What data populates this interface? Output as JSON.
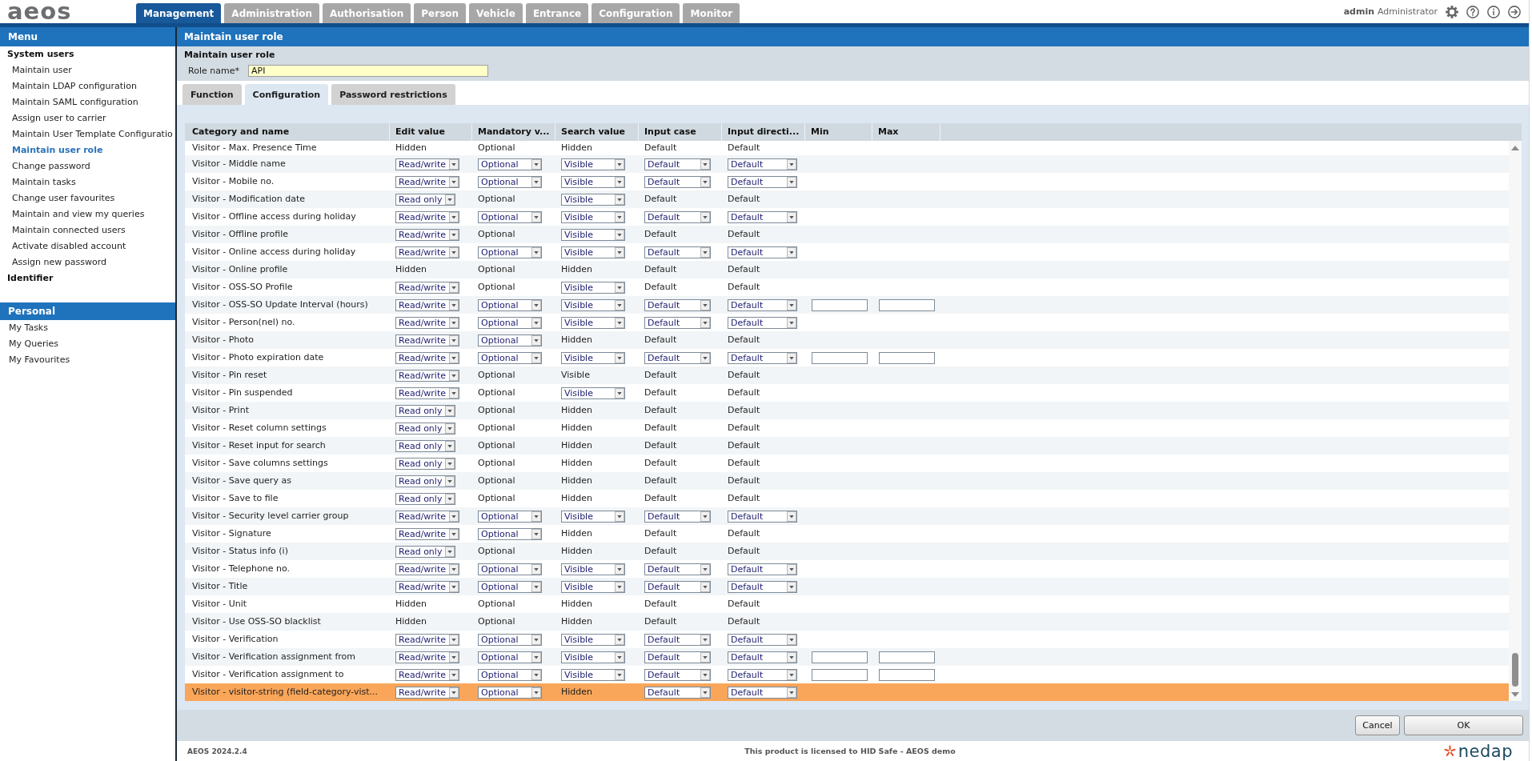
{
  "top_bar": {
    "logo": "aeos",
    "tabs": [
      {
        "label": "Management",
        "selected": true
      },
      {
        "label": "Administration",
        "selected": false
      },
      {
        "label": "Authorisation",
        "selected": false
      },
      {
        "label": "Person",
        "selected": false
      },
      {
        "label": "Vehicle",
        "selected": false
      },
      {
        "label": "Entrance",
        "selected": false
      },
      {
        "label": "Configuration",
        "selected": false
      },
      {
        "label": "Monitor",
        "selected": false
      }
    ],
    "user": {
      "login": "admin",
      "role": "Administrator"
    }
  },
  "sidebar": {
    "menu": {
      "title": "Menu",
      "groups": [
        {
          "label": "System users",
          "children": [
            {
              "label": "Maintain user",
              "selected": false
            },
            {
              "label": "Maintain LDAP configuration",
              "selected": false
            },
            {
              "label": "Maintain SAML configuration",
              "selected": false
            },
            {
              "label": "Assign user to carrier",
              "selected": false
            },
            {
              "label": "Maintain User Template Configuratio",
              "selected": false
            },
            {
              "label": "Maintain user role",
              "selected": true
            },
            {
              "label": "Change password",
              "selected": false
            },
            {
              "label": "Maintain tasks",
              "selected": false
            },
            {
              "label": "Change user favourites",
              "selected": false
            },
            {
              "label": "Maintain and view my queries",
              "selected": false
            },
            {
              "label": "Maintain connected users",
              "selected": false
            },
            {
              "label": "Activate disabled account",
              "selected": false
            },
            {
              "label": "Assign new password",
              "selected": false
            }
          ]
        },
        {
          "label": "Identifier"
        }
      ]
    },
    "personal": {
      "title": "Personal",
      "items": [
        {
          "label": "My Tasks",
          "selected": false
        },
        {
          "label": "My Queries",
          "selected": false
        },
        {
          "label": "My Favourites",
          "selected": false
        }
      ]
    }
  },
  "page": {
    "title": "Maintain user role",
    "form": {
      "title": "Maintain user role",
      "role_name": {
        "label": "Role name*",
        "value": "API"
      }
    },
    "tabs": [
      {
        "label": "Function",
        "selected": false
      },
      {
        "label": "Configuration",
        "selected": true
      },
      {
        "label": "Password restrictions",
        "selected": false
      }
    ],
    "table": {
      "columns": [
        "Category and name",
        "Edit value",
        "Mandatory v...",
        "Search value",
        "Input case",
        "Input directi...",
        "Min",
        "Max"
      ],
      "rows": [
        {
          "cells": [
            {
              "kind": "text",
              "value": "Visitor - Max. Presence Time"
            },
            {
              "kind": "text",
              "value": "Hidden"
            },
            {
              "kind": "text",
              "value": "Optional"
            },
            {
              "kind": "text",
              "value": "Hidden"
            },
            {
              "kind": "text",
              "value": "Default"
            },
            {
              "kind": "text",
              "value": "Default"
            }
          ],
          "selected": false
        },
        {
          "cells": [
            {
              "kind": "text",
              "value": "Visitor - Middle name"
            },
            {
              "kind": "select",
              "value": "Read/write"
            },
            {
              "kind": "select",
              "value": "Optional"
            },
            {
              "kind": "select",
              "value": "Visible"
            },
            {
              "kind": "select",
              "value": "Default"
            },
            {
              "kind": "select",
              "value": "Default"
            }
          ],
          "selected": false
        },
        {
          "cells": [
            {
              "kind": "text",
              "value": "Visitor - Mobile no."
            },
            {
              "kind": "select",
              "value": "Read/write"
            },
            {
              "kind": "select",
              "value": "Optional"
            },
            {
              "kind": "select",
              "value": "Visible"
            },
            {
              "kind": "select",
              "value": "Default"
            },
            {
              "kind": "select",
              "value": "Default"
            }
          ],
          "selected": false
        },
        {
          "cells": [
            {
              "kind": "text",
              "value": "Visitor - Modification date"
            },
            {
              "kind": "select",
              "value": "Read only"
            },
            {
              "kind": "text",
              "value": "Optional"
            },
            {
              "kind": "select",
              "value": "Visible"
            },
            {
              "kind": "text",
              "value": "Default"
            },
            {
              "kind": "text",
              "value": "Default"
            }
          ],
          "selected": false
        },
        {
          "cells": [
            {
              "kind": "text",
              "value": "Visitor - Offline access during holiday"
            },
            {
              "kind": "select",
              "value": "Read/write"
            },
            {
              "kind": "select",
              "value": "Optional"
            },
            {
              "kind": "select",
              "value": "Visible"
            },
            {
              "kind": "select",
              "value": "Default"
            },
            {
              "kind": "select",
              "value": "Default"
            }
          ],
          "selected": false
        },
        {
          "cells": [
            {
              "kind": "text",
              "value": "Visitor - Offline profile"
            },
            {
              "kind": "select",
              "value": "Read/write"
            },
            {
              "kind": "text",
              "value": "Optional"
            },
            {
              "kind": "select",
              "value": "Visible"
            },
            {
              "kind": "text",
              "value": "Default"
            },
            {
              "kind": "text",
              "value": "Default"
            }
          ],
          "selected": false
        },
        {
          "cells": [
            {
              "kind": "text",
              "value": "Visitor - Online access during holiday"
            },
            {
              "kind": "select",
              "value": "Read/write"
            },
            {
              "kind": "select",
              "value": "Optional"
            },
            {
              "kind": "select",
              "value": "Visible"
            },
            {
              "kind": "select",
              "value": "Default"
            },
            {
              "kind": "select",
              "value": "Default"
            }
          ],
          "selected": false
        },
        {
          "cells": [
            {
              "kind": "text",
              "value": "Visitor - Online profile"
            },
            {
              "kind": "text",
              "value": "Hidden"
            },
            {
              "kind": "text",
              "value": "Optional"
            },
            {
              "kind": "text",
              "value": "Hidden"
            },
            {
              "kind": "text",
              "value": "Default"
            },
            {
              "kind": "text",
              "value": "Default"
            }
          ],
          "selected": false
        },
        {
          "cells": [
            {
              "kind": "text",
              "value": "Visitor - OSS-SO Profile"
            },
            {
              "kind": "select",
              "value": "Read/write"
            },
            {
              "kind": "text",
              "value": "Optional"
            },
            {
              "kind": "select",
              "value": "Visible"
            },
            {
              "kind": "text",
              "value": "Default"
            },
            {
              "kind": "text",
              "value": "Default"
            }
          ],
          "selected": false
        },
        {
          "cells": [
            {
              "kind": "text",
              "value": "Visitor - OSS-SO Update Interval (hours)"
            },
            {
              "kind": "select",
              "value": "Read/write"
            },
            {
              "kind": "select",
              "value": "Optional"
            },
            {
              "kind": "select",
              "value": "Visible"
            },
            {
              "kind": "select",
              "value": "Default"
            },
            {
              "kind": "select",
              "value": "Default"
            },
            {
              "kind": "input"
            },
            {
              "kind": "input"
            }
          ],
          "selected": false
        },
        {
          "cells": [
            {
              "kind": "text",
              "value": "Visitor - Person(nel) no."
            },
            {
              "kind": "select",
              "value": "Read/write"
            },
            {
              "kind": "select",
              "value": "Optional"
            },
            {
              "kind": "select",
              "value": "Visible"
            },
            {
              "kind": "select",
              "value": "Default"
            },
            {
              "kind": "select",
              "value": "Default"
            }
          ],
          "selected": false
        },
        {
          "cells": [
            {
              "kind": "text",
              "value": "Visitor - Photo"
            },
            {
              "kind": "select",
              "value": "Read/write"
            },
            {
              "kind": "select",
              "value": "Optional"
            },
            {
              "kind": "text",
              "value": "Hidden"
            },
            {
              "kind": "text",
              "value": "Default"
            },
            {
              "kind": "text",
              "value": "Default"
            }
          ],
          "selected": false
        },
        {
          "cells": [
            {
              "kind": "text",
              "value": "Visitor - Photo expiration date"
            },
            {
              "kind": "select",
              "value": "Read/write"
            },
            {
              "kind": "select",
              "value": "Optional"
            },
            {
              "kind": "select",
              "value": "Visible"
            },
            {
              "kind": "select",
              "value": "Default"
            },
            {
              "kind": "select",
              "value": "Default"
            },
            {
              "kind": "input"
            },
            {
              "kind": "input"
            }
          ],
          "selected": false
        },
        {
          "cells": [
            {
              "kind": "text",
              "value": "Visitor - Pin reset"
            },
            {
              "kind": "select",
              "value": "Read/write"
            },
            {
              "kind": "text",
              "value": "Optional"
            },
            {
              "kind": "text",
              "value": "Visible"
            },
            {
              "kind": "text",
              "value": "Default"
            },
            {
              "kind": "text",
              "value": "Default"
            }
          ],
          "selected": false
        },
        {
          "cells": [
            {
              "kind": "text",
              "value": "Visitor - Pin suspended"
            },
            {
              "kind": "select",
              "value": "Read/write"
            },
            {
              "kind": "text",
              "value": "Optional"
            },
            {
              "kind": "select",
              "value": "Visible"
            },
            {
              "kind": "text",
              "value": "Default"
            },
            {
              "kind": "text",
              "value": "Default"
            }
          ],
          "selected": false
        },
        {
          "cells": [
            {
              "kind": "text",
              "value": "Visitor - Print"
            },
            {
              "kind": "select",
              "value": "Read only"
            },
            {
              "kind": "text",
              "value": "Optional"
            },
            {
              "kind": "text",
              "value": "Hidden"
            },
            {
              "kind": "text",
              "value": "Default"
            },
            {
              "kind": "text",
              "value": "Default"
            }
          ],
          "selected": false
        },
        {
          "cells": [
            {
              "kind": "text",
              "value": "Visitor - Reset column settings"
            },
            {
              "kind": "select",
              "value": "Read only"
            },
            {
              "kind": "text",
              "value": "Optional"
            },
            {
              "kind": "text",
              "value": "Hidden"
            },
            {
              "kind": "text",
              "value": "Default"
            },
            {
              "kind": "text",
              "value": "Default"
            }
          ],
          "selected": false
        },
        {
          "cells": [
            {
              "kind": "text",
              "value": "Visitor - Reset input for search"
            },
            {
              "kind": "select",
              "value": "Read only"
            },
            {
              "kind": "text",
              "value": "Optional"
            },
            {
              "kind": "text",
              "value": "Hidden"
            },
            {
              "kind": "text",
              "value": "Default"
            },
            {
              "kind": "text",
              "value": "Default"
            }
          ],
          "selected": false
        },
        {
          "cells": [
            {
              "kind": "text",
              "value": "Visitor - Save columns settings"
            },
            {
              "kind": "select",
              "value": "Read only"
            },
            {
              "kind": "text",
              "value": "Optional"
            },
            {
              "kind": "text",
              "value": "Hidden"
            },
            {
              "kind": "text",
              "value": "Default"
            },
            {
              "kind": "text",
              "value": "Default"
            }
          ],
          "selected": false
        },
        {
          "cells": [
            {
              "kind": "text",
              "value": "Visitor - Save query as"
            },
            {
              "kind": "select",
              "value": "Read only"
            },
            {
              "kind": "text",
              "value": "Optional"
            },
            {
              "kind": "text",
              "value": "Hidden"
            },
            {
              "kind": "text",
              "value": "Default"
            },
            {
              "kind": "text",
              "value": "Default"
            }
          ],
          "selected": false
        },
        {
          "cells": [
            {
              "kind": "text",
              "value": "Visitor - Save to file"
            },
            {
              "kind": "select",
              "value": "Read only"
            },
            {
              "kind": "text",
              "value": "Optional"
            },
            {
              "kind": "text",
              "value": "Hidden"
            },
            {
              "kind": "text",
              "value": "Default"
            },
            {
              "kind": "text",
              "value": "Default"
            }
          ],
          "selected": false
        },
        {
          "cells": [
            {
              "kind": "text",
              "value": "Visitor - Security level carrier group"
            },
            {
              "kind": "select",
              "value": "Read/write"
            },
            {
              "kind": "select",
              "value": "Optional"
            },
            {
              "kind": "select",
              "value": "Visible"
            },
            {
              "kind": "select",
              "value": "Default"
            },
            {
              "kind": "select",
              "value": "Default"
            }
          ],
          "selected": false
        },
        {
          "cells": [
            {
              "kind": "text",
              "value": "Visitor - Signature"
            },
            {
              "kind": "select",
              "value": "Read/write"
            },
            {
              "kind": "select",
              "value": "Optional"
            },
            {
              "kind": "text",
              "value": "Hidden"
            },
            {
              "kind": "text",
              "value": "Default"
            },
            {
              "kind": "text",
              "value": "Default"
            }
          ],
          "selected": false
        },
        {
          "cells": [
            {
              "kind": "text",
              "value": "Visitor - Status info (i)"
            },
            {
              "kind": "select",
              "value": "Read only"
            },
            {
              "kind": "text",
              "value": "Optional"
            },
            {
              "kind": "text",
              "value": "Hidden"
            },
            {
              "kind": "text",
              "value": "Default"
            },
            {
              "kind": "text",
              "value": "Default"
            }
          ],
          "selected": false
        },
        {
          "cells": [
            {
              "kind": "text",
              "value": "Visitor - Telephone no."
            },
            {
              "kind": "select",
              "value": "Read/write"
            },
            {
              "kind": "select",
              "value": "Optional"
            },
            {
              "kind": "select",
              "value": "Visible"
            },
            {
              "kind": "select",
              "value": "Default"
            },
            {
              "kind": "select",
              "value": "Default"
            }
          ],
          "selected": false
        },
        {
          "cells": [
            {
              "kind": "text",
              "value": "Visitor - Title"
            },
            {
              "kind": "select",
              "value": "Read/write"
            },
            {
              "kind": "select",
              "value": "Optional"
            },
            {
              "kind": "select",
              "value": "Visible"
            },
            {
              "kind": "select",
              "value": "Default"
            },
            {
              "kind": "select",
              "value": "Default"
            }
          ],
          "selected": false
        },
        {
          "cells": [
            {
              "kind": "text",
              "value": "Visitor - Unit"
            },
            {
              "kind": "text",
              "value": "Hidden"
            },
            {
              "kind": "text",
              "value": "Optional"
            },
            {
              "kind": "text",
              "value": "Hidden"
            },
            {
              "kind": "text",
              "value": "Default"
            },
            {
              "kind": "text",
              "value": "Default"
            }
          ],
          "selected": false
        },
        {
          "cells": [
            {
              "kind": "text",
              "value": "Visitor - Use OSS-SO blacklist"
            },
            {
              "kind": "text",
              "value": "Hidden"
            },
            {
              "kind": "text",
              "value": "Optional"
            },
            {
              "kind": "text",
              "value": "Hidden"
            },
            {
              "kind": "text",
              "value": "Default"
            },
            {
              "kind": "text",
              "value": "Default"
            }
          ],
          "selected": false
        },
        {
          "cells": [
            {
              "kind": "text",
              "value": "Visitor - Verification"
            },
            {
              "kind": "select",
              "value": "Read/write"
            },
            {
              "kind": "select",
              "value": "Optional"
            },
            {
              "kind": "select",
              "value": "Visible"
            },
            {
              "kind": "select",
              "value": "Default"
            },
            {
              "kind": "select",
              "value": "Default"
            }
          ],
          "selected": false
        },
        {
          "cells": [
            {
              "kind": "text",
              "value": "Visitor - Verification assignment from"
            },
            {
              "kind": "select",
              "value": "Read/write"
            },
            {
              "kind": "select",
              "value": "Optional"
            },
            {
              "kind": "select",
              "value": "Visible"
            },
            {
              "kind": "select",
              "value": "Default"
            },
            {
              "kind": "select",
              "value": "Default"
            },
            {
              "kind": "input"
            },
            {
              "kind": "input"
            }
          ],
          "selected": false
        },
        {
          "cells": [
            {
              "kind": "text",
              "value": "Visitor - Verification assignment to"
            },
            {
              "kind": "select",
              "value": "Read/write"
            },
            {
              "kind": "select",
              "value": "Optional"
            },
            {
              "kind": "select",
              "value": "Visible"
            },
            {
              "kind": "select",
              "value": "Default"
            },
            {
              "kind": "select",
              "value": "Default"
            },
            {
              "kind": "input"
            },
            {
              "kind": "input"
            }
          ],
          "selected": false
        },
        {
          "cells": [
            {
              "kind": "text",
              "value": "Visitor - visitor-string (field-category-vist..."
            },
            {
              "kind": "select",
              "value": "Read/write"
            },
            {
              "kind": "select",
              "value": "Optional"
            },
            {
              "kind": "text",
              "value": "Hidden"
            },
            {
              "kind": "select",
              "value": "Default"
            },
            {
              "kind": "select",
              "value": "Default"
            }
          ],
          "selected": true
        }
      ]
    },
    "buttons": [
      "Cancel",
      "OK"
    ]
  },
  "status_bar": {
    "version": "AEOS 2024.2.4",
    "license": "This product is licensed to HID Safe - AEOS demo",
    "logo": "nedap"
  }
}
